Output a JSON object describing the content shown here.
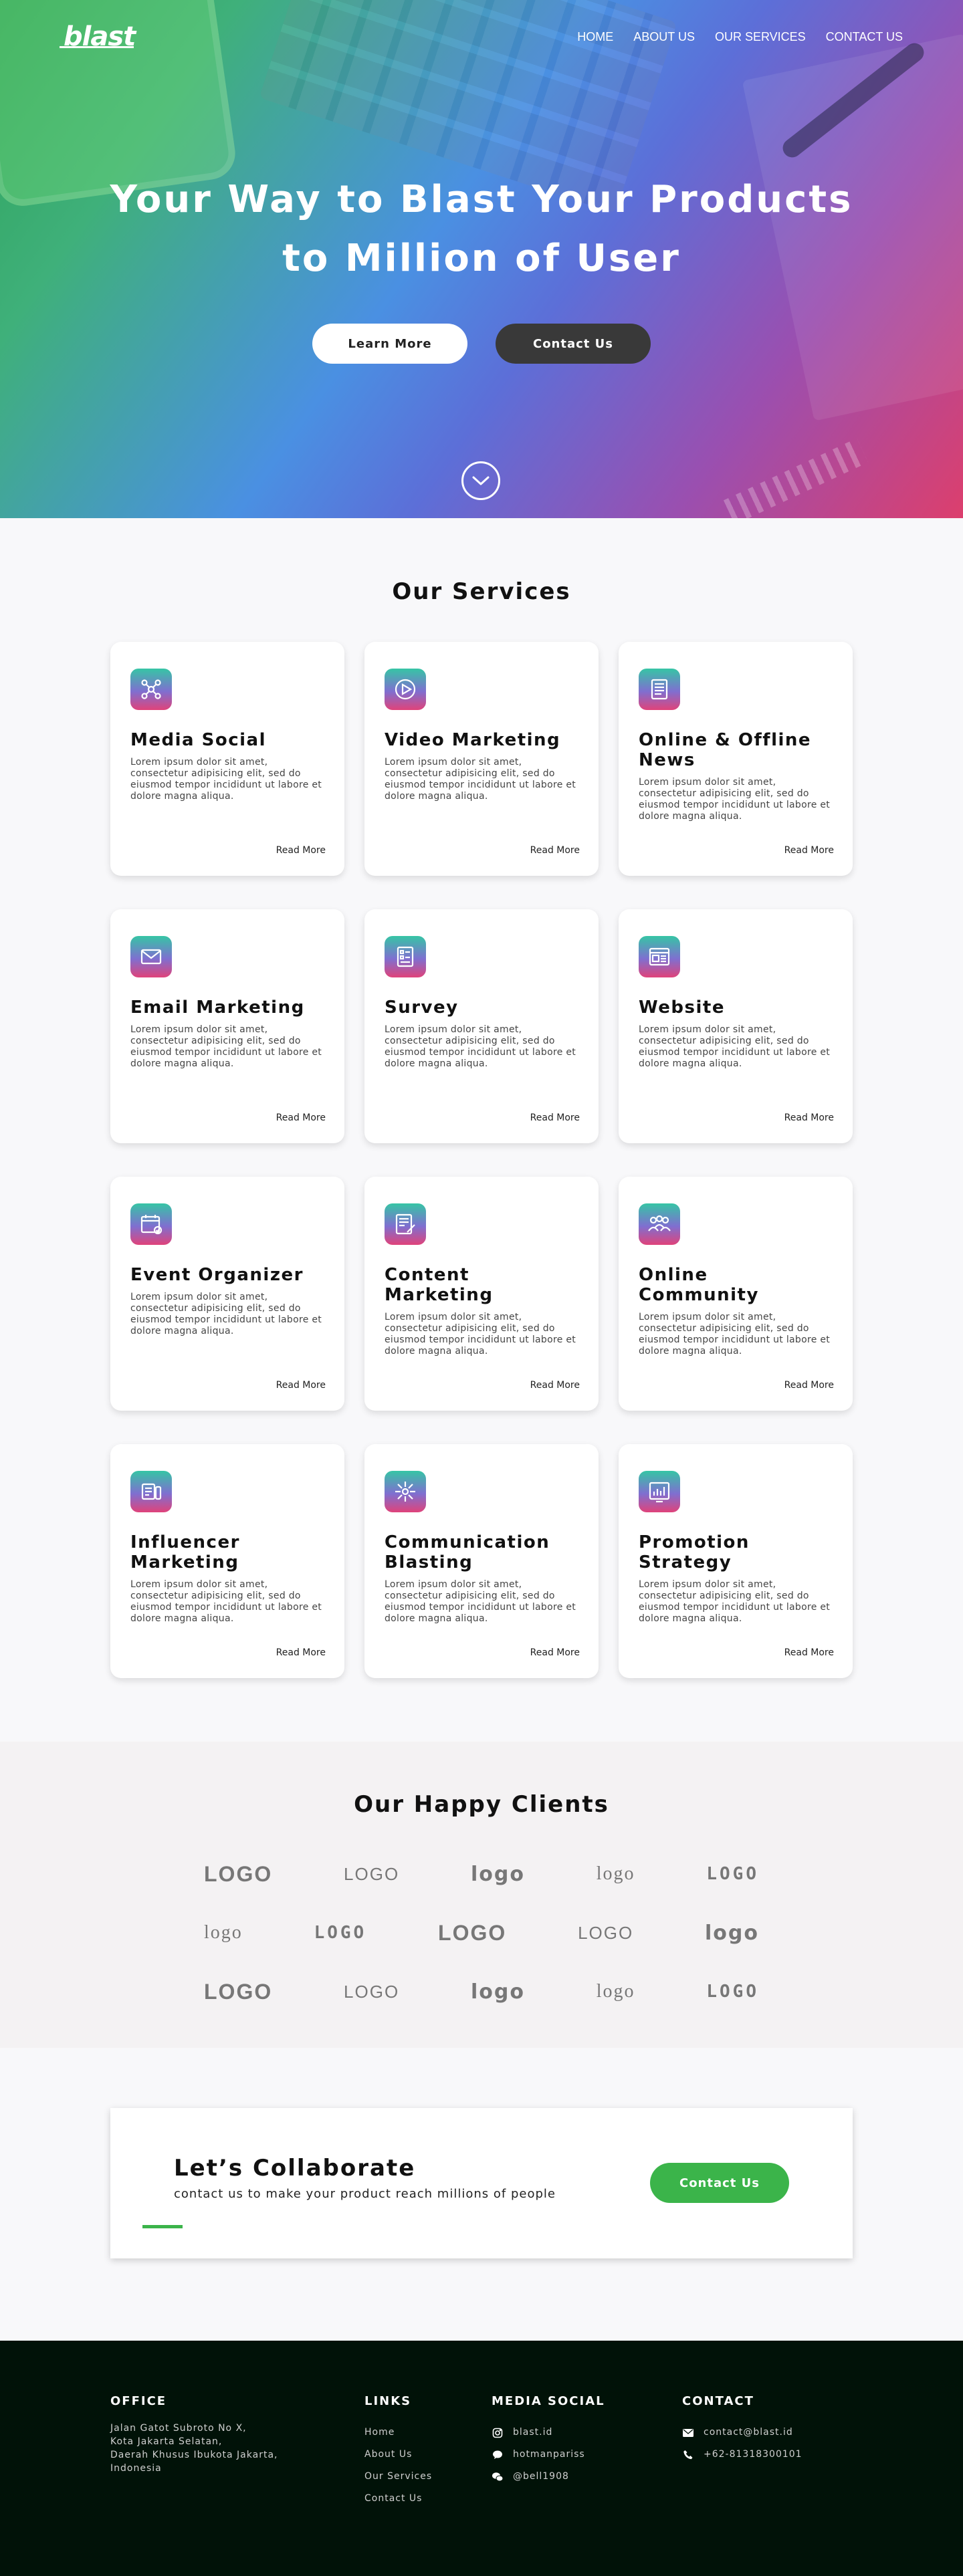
{
  "nav": {
    "logo": "blast",
    "items": [
      "HOME",
      "ABOUT US",
      "OUR SERVICES",
      "CONTACT US"
    ]
  },
  "hero": {
    "title_line1": "Your Way to Blast Your Products",
    "title_line2": "to Million of User",
    "primary_button": "Learn More",
    "secondary_button": "Contact Us",
    "scroll_icon": "chevron-down-icon"
  },
  "services": {
    "title": "Our Services",
    "read_more": "Read More",
    "items": [
      {
        "title": "Media Social",
        "icon": "share-network-icon",
        "text": "Lorem ipsum dolor sit amet, consectetur adipisicing elit, sed do eiusmod tempor incididunt ut labore et dolore magna aliqua."
      },
      {
        "title": "Video Marketing",
        "icon": "play-icon",
        "text": "Lorem ipsum dolor sit amet, consectetur adipisicing elit, sed do eiusmod tempor incididunt ut labore et dolore magna aliqua."
      },
      {
        "title": "Online & Offline News",
        "icon": "news-icon",
        "text": "Lorem ipsum dolor sit amet, consectetur adipisicing elit, sed do eiusmod tempor incididunt ut labore et dolore magna aliqua."
      },
      {
        "title": "Email Marketing",
        "icon": "envelope-icon",
        "text": "Lorem ipsum dolor sit amet, consectetur adipisicing elit, sed do eiusmod tempor incididunt ut labore et dolore magna aliqua."
      },
      {
        "title": "Survey",
        "icon": "survey-form-icon",
        "text": "Lorem ipsum dolor sit amet, consectetur adipisicing elit, sed do eiusmod tempor incididunt ut labore et dolore magna aliqua."
      },
      {
        "title": "Website",
        "icon": "website-icon",
        "text": "Lorem ipsum dolor sit amet, consectetur adipisicing elit, sed do eiusmod tempor incididunt ut labore et dolore magna aliqua."
      },
      {
        "title": "Event Organizer",
        "icon": "calendar-check-icon",
        "text": "Lorem ipsum dolor sit amet, consectetur adipisicing elit, sed do eiusmod tempor incididunt ut labore et dolore magna aliqua."
      },
      {
        "title": "Content Marketing",
        "icon": "content-edit-icon",
        "text": "Lorem ipsum dolor sit amet, consectetur adipisicing elit, sed do eiusmod tempor incididunt ut labore et dolore magna aliqua."
      },
      {
        "title": "Online Community",
        "icon": "community-icon",
        "text": "Lorem ipsum dolor sit amet, consectetur adipisicing elit, sed do eiusmod tempor incididunt ut labore et dolore magna aliqua."
      },
      {
        "title": "Influencer Marketing",
        "icon": "influencer-icon",
        "text": "Lorem ipsum dolor sit amet, consectetur adipisicing elit, sed do eiusmod tempor incididunt ut labore et dolore magna aliqua."
      },
      {
        "title": "Communication Blasting",
        "icon": "broadcast-icon",
        "text": "Lorem ipsum dolor sit amet, consectetur adipisicing elit, sed do eiusmod tempor incididunt ut labore et dolore magna aliqua."
      },
      {
        "title": "Promotion Strategy",
        "icon": "chart-board-icon",
        "text": "Lorem ipsum dolor sit amet, consectetur adipisicing elit, sed do eiusmod tempor incididunt ut labore et dolore magna aliqua."
      }
    ]
  },
  "clients": {
    "title": "Our Happy Clients",
    "rows": [
      [
        "LOGO",
        "LOGO",
        "logo",
        "logo",
        "LOGO"
      ],
      [
        "logo",
        "LOGO",
        "LOGO",
        "LOGO",
        "logo"
      ],
      [
        "LOGO",
        "LOGO",
        "logo",
        "logo",
        "LOGO"
      ]
    ]
  },
  "collab": {
    "title": "Let’s Collaborate",
    "subtitle": "contact us to make your product reach millions of people",
    "button": "Contact Us",
    "accent": "#3bb44a"
  },
  "footer": {
    "office": {
      "heading": "OFFICE",
      "lines": [
        "Jalan Gatot Subroto No X,",
        "Kota Jakarta Selatan,",
        "Daerah Khusus Ibukota Jakarta,",
        "Indonesia"
      ]
    },
    "links": {
      "heading": "LINKS",
      "items": [
        "Home",
        "About Us",
        "Our Services",
        "Contact Us"
      ]
    },
    "social": {
      "heading": "MEDIA SOCIAL",
      "items": [
        {
          "icon": "instagram-icon",
          "text": "blast.id"
        },
        {
          "icon": "line-icon",
          "text": "hotmanpariss"
        },
        {
          "icon": "wechat-icon",
          "text": "@bell1908"
        }
      ]
    },
    "contact": {
      "heading": "CONTACT",
      "items": [
        {
          "icon": "mail-icon",
          "text": "contact@blast.id"
        },
        {
          "icon": "phone-icon",
          "text": "+62-81318300101"
        }
      ]
    }
  }
}
